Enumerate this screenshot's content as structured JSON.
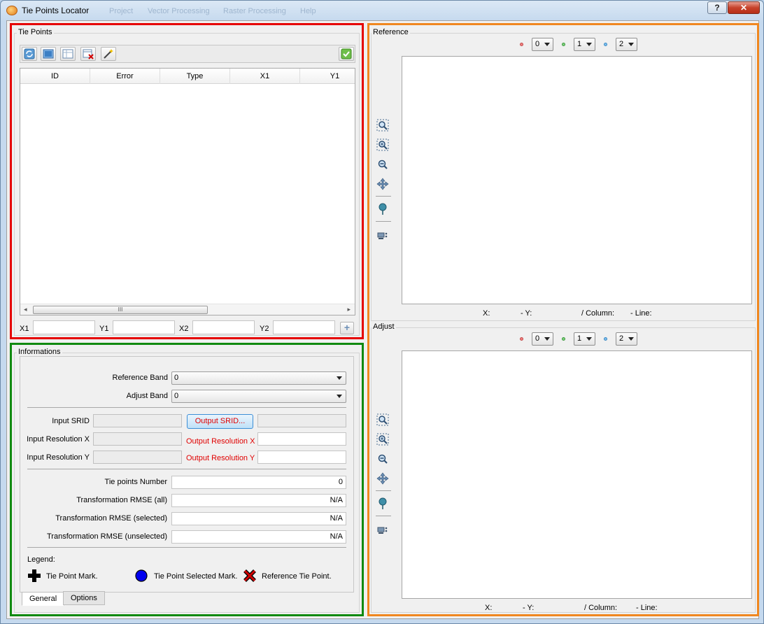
{
  "window": {
    "title": "Tie Points Locator",
    "help_label": "?",
    "close_label": "✕",
    "background_menu": [
      "Project",
      "Vector Processing",
      "Raster Processing",
      "Help"
    ]
  },
  "tie_points": {
    "group_title": "Tie Points",
    "toolbar_icons": [
      "refresh-icon",
      "select-all-icon",
      "table-icon",
      "delete-icon",
      "auto-acquire-wand-icon",
      "apply-checkmark-icon"
    ],
    "columns": [
      "ID",
      "Error",
      "Type",
      "X1",
      "Y1"
    ],
    "scroll_grip": "III",
    "coords": {
      "x1_label": "X1",
      "y1_label": "Y1",
      "x2_label": "X2",
      "y2_label": "Y2",
      "x1_value": "",
      "y1_value": "",
      "x2_value": "",
      "y2_value": ""
    },
    "add_label": "+"
  },
  "informations": {
    "group_title": "Informations",
    "reference_band_label": "Reference Band",
    "reference_band_value": "0",
    "adjust_band_label": "Adjust Band",
    "adjust_band_value": "0",
    "input_srid_label": "Input SRID",
    "input_srid_value": "",
    "output_srid_button": "Output SRID...",
    "output_srid_value": "",
    "input_res_x_label": "Input Resolution X",
    "input_res_x_value": "",
    "output_res_x_label": "Output Resolution X",
    "output_res_x_value": "",
    "input_res_y_label": "Input Resolution Y",
    "input_res_y_value": "",
    "output_res_y_label": "Output Resolution Y",
    "output_res_y_value": "",
    "tie_points_number_label": "Tie points Number",
    "tie_points_number_value": "0",
    "rmse_all_label": "Transformation RMSE (all)",
    "rmse_all_value": "N/A",
    "rmse_selected_label": "Transformation RMSE (selected)",
    "rmse_selected_value": "N/A",
    "rmse_unselected_label": "Transformation RMSE (unselected)",
    "rmse_unselected_value": "N/A",
    "legend_title": "Legend:",
    "legend_mark": "Tie Point Mark.",
    "legend_selected": "Tie Point Selected Mark.",
    "legend_reference": "Reference Tie Point.",
    "tabs": [
      "General",
      "Options"
    ]
  },
  "reference": {
    "group_title": "Reference",
    "bands": [
      "0",
      "1",
      "2"
    ],
    "coords": {
      "x": "X:",
      "y": "- Y:",
      "column": "/ Column:",
      "line": "- Line:"
    }
  },
  "adjust": {
    "group_title": "Adjust",
    "bands": [
      "0",
      "1",
      "2"
    ],
    "coords": {
      "x": "X:",
      "y": "- Y:",
      "column": "/ Column:",
      "line": "- Line:"
    }
  },
  "colors": {
    "red_frame": "#e60000",
    "green_frame": "#108a10",
    "orange_frame": "#f0871f",
    "band_red": "#f08080",
    "band_green": "#7fd07f",
    "band_blue": "#7fbfee",
    "selected_mark": "#0000ee",
    "reference_mark": "#d00000"
  }
}
